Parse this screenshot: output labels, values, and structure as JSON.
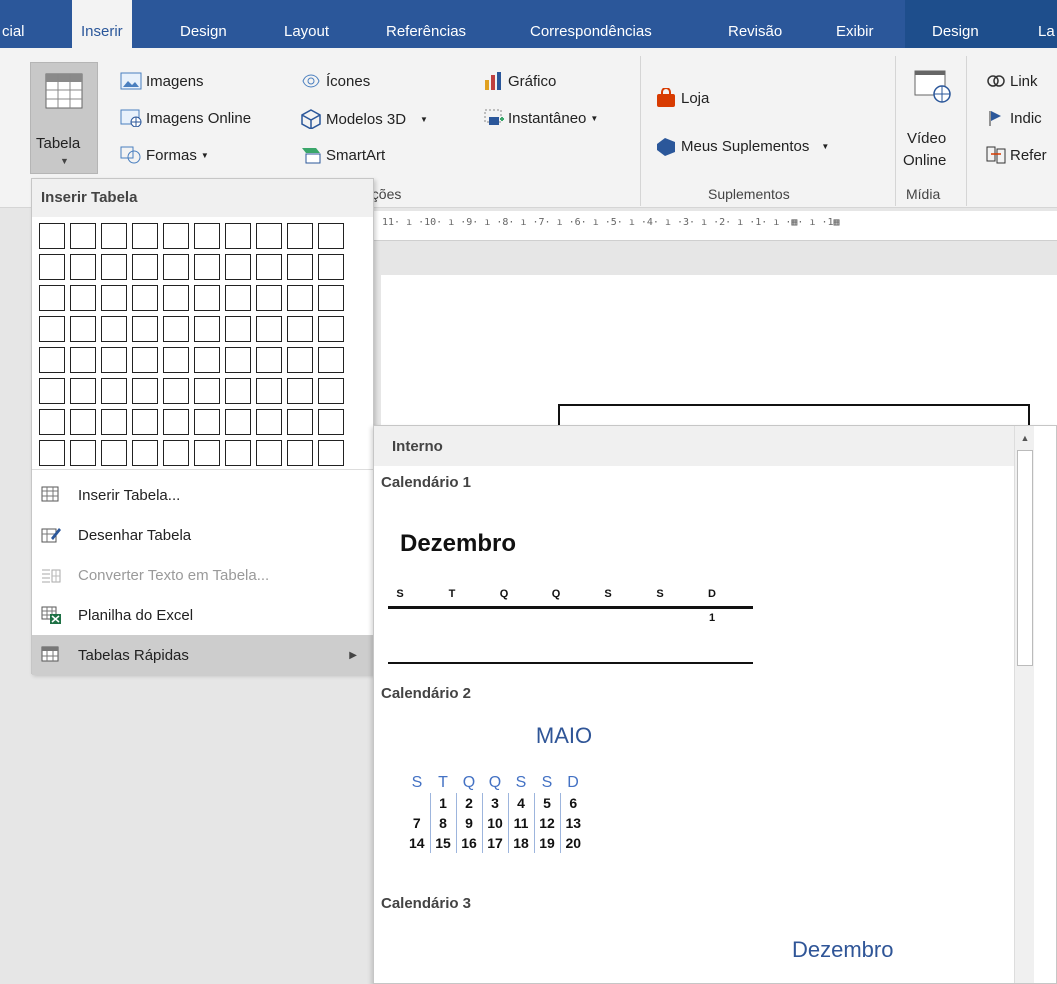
{
  "tabs": [
    "cial",
    "Inserir",
    "Design",
    "Layout",
    "Referências",
    "Correspondências",
    "Revisão",
    "Exibir",
    "Design",
    "La"
  ],
  "ribbon": {
    "tabela_label": "Tabela",
    "imagens": "Imagens",
    "imagens_online": "Imagens Online",
    "formas": "Formas",
    "icones": "Ícones",
    "modelos3d": "Modelos 3D",
    "smartart": "SmartArt",
    "grafico": "Gráfico",
    "instantaneo": "Instantâneo",
    "loja": "Loja",
    "meus_suplementos": "Meus Suplementos",
    "video_line1": "Vídeo",
    "video_line2": "Online",
    "link": "Link",
    "indice": "Indic",
    "referencia": "Refer",
    "group_ilustracoes": "ações",
    "group_suplementos": "Suplementos",
    "group_midia": "Mídia"
  },
  "ruler_text": "11· ı ·10· ı ·9· ı ·8· ı ·7· ı ·6· ı ·5· ı ·4· ı ·3· ı ·2· ı ·1· ı ·▦· ı ·1▦",
  "table_menu": {
    "title": "Inserir Tabela",
    "grid_cols": 10,
    "grid_rows": 8,
    "items": [
      {
        "label": "Inserir Tabela...",
        "disabled": false,
        "submenu": false
      },
      {
        "label": "Desenhar Tabela",
        "disabled": false,
        "submenu": false
      },
      {
        "label": "Converter Texto em Tabela...",
        "disabled": true,
        "submenu": false
      },
      {
        "label": "Planilha do Excel",
        "disabled": false,
        "submenu": false
      },
      {
        "label": "Tabelas Rápidas",
        "disabled": false,
        "submenu": true,
        "highlighted": true
      }
    ]
  },
  "quick_tables": {
    "header": "Interno",
    "cal1": {
      "name": "Calendário 1",
      "month": "Dezembro",
      "days": [
        "S",
        "T",
        "Q",
        "Q",
        "S",
        "S",
        "D"
      ],
      "first": "1"
    },
    "cal2": {
      "name": "Calendário 2",
      "month": "MAIO",
      "days": [
        "S",
        "T",
        "Q",
        "Q",
        "S",
        "S",
        "D"
      ],
      "rows": [
        [
          "",
          "1",
          "2",
          "3",
          "4",
          "5",
          "6"
        ],
        [
          "7",
          "8",
          "9",
          "10",
          "11",
          "12",
          "13"
        ],
        [
          "14",
          "15",
          "16",
          "17",
          "18",
          "19",
          "20"
        ]
      ]
    },
    "cal3": {
      "name": "Calendário 3",
      "month": "Dezembro"
    }
  }
}
